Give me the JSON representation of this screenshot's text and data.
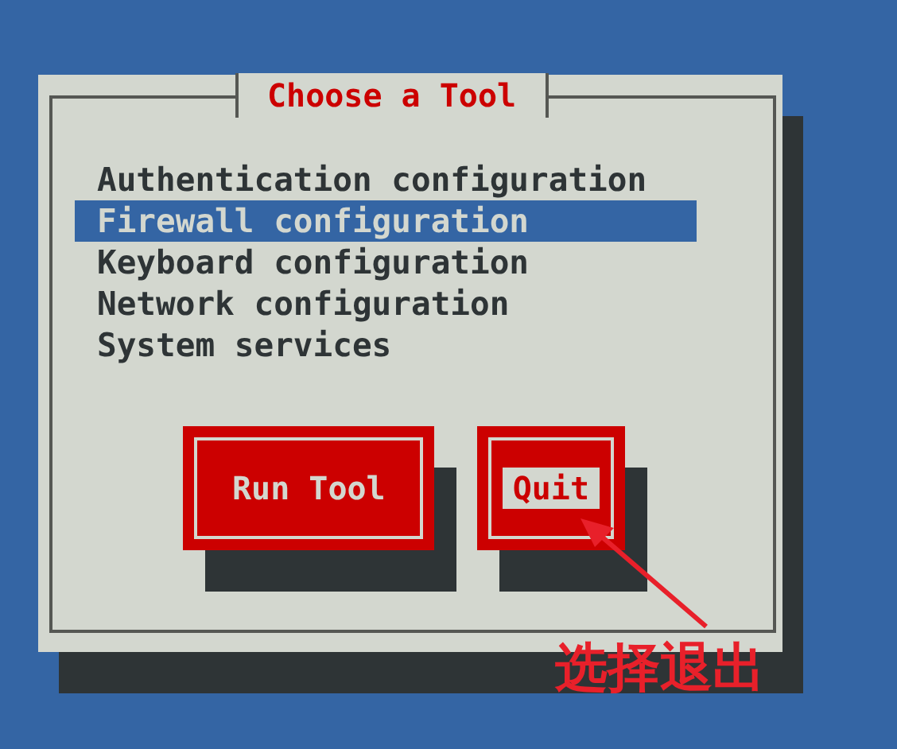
{
  "dialog": {
    "title": "Choose a Tool",
    "items": [
      {
        "label": "Authentication configuration",
        "selected": false
      },
      {
        "label": "Firewall configuration",
        "selected": true
      },
      {
        "label": "Keyboard configuration",
        "selected": false
      },
      {
        "label": "Network configuration",
        "selected": false
      },
      {
        "label": "System services",
        "selected": false
      }
    ],
    "buttons": [
      {
        "label": "Run Tool",
        "focused": false
      },
      {
        "label": "Quit",
        "focused": true
      }
    ]
  },
  "annotation": {
    "text": "选择退出"
  }
}
